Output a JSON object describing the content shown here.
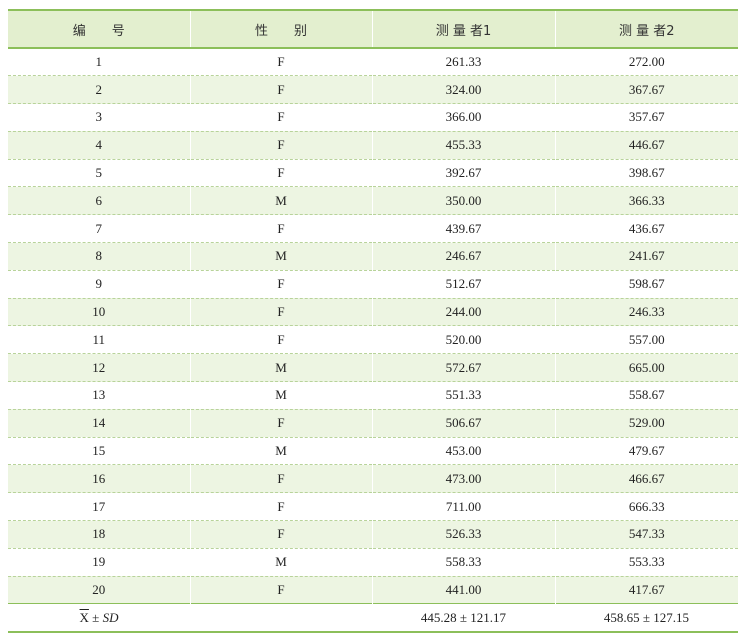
{
  "table": {
    "headers": [
      "编　　号",
      "性　　别",
      "测 量 者1",
      "测 量 者2"
    ],
    "rows": [
      {
        "id": "1",
        "sex": "F",
        "m1": "261.33",
        "m2": "272.00"
      },
      {
        "id": "2",
        "sex": "F",
        "m1": "324.00",
        "m2": "367.67"
      },
      {
        "id": "3",
        "sex": "F",
        "m1": "366.00",
        "m2": "357.67"
      },
      {
        "id": "4",
        "sex": "F",
        "m1": "455.33",
        "m2": "446.67"
      },
      {
        "id": "5",
        "sex": "F",
        "m1": "392.67",
        "m2": "398.67"
      },
      {
        "id": "6",
        "sex": "M",
        "m1": "350.00",
        "m2": "366.33"
      },
      {
        "id": "7",
        "sex": "F",
        "m1": "439.67",
        "m2": "436.67"
      },
      {
        "id": "8",
        "sex": "M",
        "m1": "246.67",
        "m2": "241.67"
      },
      {
        "id": "9",
        "sex": "F",
        "m1": "512.67",
        "m2": "598.67"
      },
      {
        "id": "10",
        "sex": "F",
        "m1": "244.00",
        "m2": "246.33"
      },
      {
        "id": "11",
        "sex": "F",
        "m1": "520.00",
        "m2": "557.00"
      },
      {
        "id": "12",
        "sex": "M",
        "m1": "572.67",
        "m2": "665.00"
      },
      {
        "id": "13",
        "sex": "M",
        "m1": "551.33",
        "m2": "558.67"
      },
      {
        "id": "14",
        "sex": "F",
        "m1": "506.67",
        "m2": "529.00"
      },
      {
        "id": "15",
        "sex": "M",
        "m1": "453.00",
        "m2": "479.67"
      },
      {
        "id": "16",
        "sex": "F",
        "m1": "473.00",
        "m2": "466.67"
      },
      {
        "id": "17",
        "sex": "F",
        "m1": "711.00",
        "m2": "666.33"
      },
      {
        "id": "18",
        "sex": "F",
        "m1": "526.33",
        "m2": "547.33"
      },
      {
        "id": "19",
        "sex": "M",
        "m1": "558.33",
        "m2": "553.33"
      },
      {
        "id": "20",
        "sex": "F",
        "m1": "441.00",
        "m2": "417.67"
      }
    ],
    "summary": {
      "label_x": "X",
      "label_pm": " ± ",
      "label_sd": "SD",
      "sex": "",
      "m1": "445.28 ± 121.17",
      "m2": "458.65 ± 127.15"
    }
  },
  "colors": {
    "header_bg": "#e3efcf",
    "stripe_bg": "#edf5e2",
    "rule": "#8cbf5a"
  }
}
